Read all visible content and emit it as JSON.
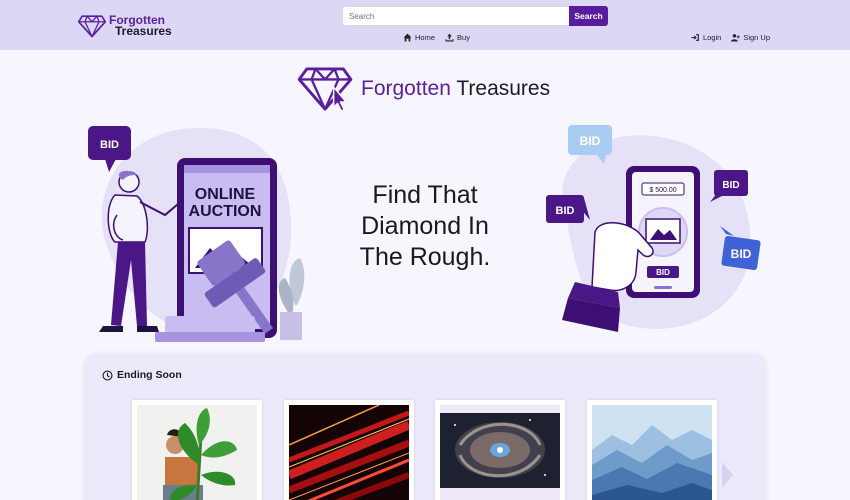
{
  "brand": {
    "line1": "Forgotten",
    "line2": "Treasures"
  },
  "search": {
    "placeholder": "Search",
    "button_label": "Search"
  },
  "nav": {
    "home_label": "Home",
    "buy_label": "Buy",
    "login_label": "Login",
    "signup_label": "Sign Up"
  },
  "hero": {
    "logo_title_part1": "Forgotten",
    "logo_title_part2": " Treasures",
    "tagline_line1": "Find That",
    "tagline_line2": "Diamond In",
    "tagline_line3": "The Rough."
  },
  "illustration_left": {
    "bid_bubble": "BID",
    "screen_line1": "ONLINE",
    "screen_line2": "AUCTION"
  },
  "illustration_right": {
    "bubble1": "BID",
    "bubble2": "BID",
    "bubble3": "BID",
    "bubble4": "BID",
    "price": "$ 500.00",
    "bid_button": "BID"
  },
  "ending_soon": {
    "title": "Ending Soon",
    "items": [
      {
        "image": "person-holding-plant"
      },
      {
        "image": "red-light-streaks"
      },
      {
        "image": "spiral-galaxy"
      },
      {
        "image": "blue-mountains"
      }
    ]
  },
  "colors": {
    "brand_purple": "#5b1b9e",
    "navbar_bg": "#dcd7f4",
    "page_bg": "#f7f5fd",
    "panel_bg": "#ede9fb"
  },
  "icons": {
    "logo": "diamond-cursor-icon",
    "home": "home-icon",
    "buy": "upload-icon",
    "login": "login-icon",
    "signup": "user-plus-icon",
    "clock": "clock-icon",
    "next": "chevron-right-icon"
  }
}
